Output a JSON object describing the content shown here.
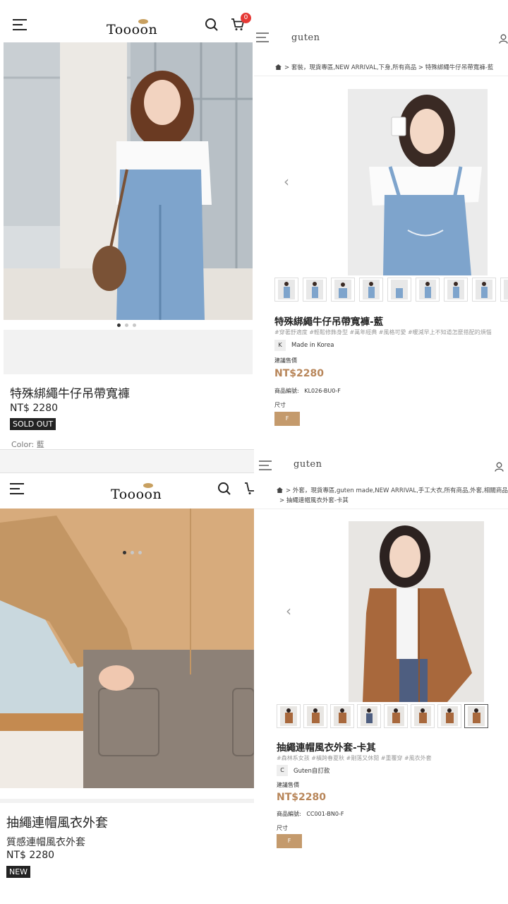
{
  "top_left": {
    "logo": "Toooon",
    "cart_count": "0",
    "product_title": "特殊綁繩牛仔吊帶寬褲",
    "price": "NT$ 2280",
    "status_badge": "SOLD OUT",
    "color_label": "Color: 藍",
    "carousel_active_index": 0,
    "carousel_count": 3
  },
  "top_right": {
    "logo": "guten",
    "breadcrumb": ">   套裝，現貨專區,NEW ARRIVAL,下身,所有商品   >   特殊綁繩牛仔吊帶寬褲-藍",
    "product_title": "特殊綁繩牛仔吊帶寬褲-藍",
    "tags": "#穿著舒適度 #輕鬆修飾身型 #萬年經典 #風格可愛 #暖減早上不知道怎麼搭配的煩惱",
    "origin_code": "K",
    "origin_text": "Made in Korea",
    "price_label": "建議售價",
    "price": "NT$2280",
    "sku_label": "商品編號:",
    "sku": "KL026-BU0-F",
    "size_label": "尺寸",
    "size_option": "F",
    "thumb_count": 9
  },
  "bottom_left": {
    "logo": "Toooon",
    "product_title": "抽繩連帽風衣外套",
    "subtitle": "質感連帽風衣外套",
    "price": "NT$ 2280",
    "status_badge": "NEW",
    "carousel_active_index": 0,
    "carousel_count": 3
  },
  "bottom_right": {
    "logo": "guten",
    "breadcrumb_line1": ">   外套，現貨專區,guten made,NEW ARRIVAL,手工大衣,所有商品,外套,相關商品",
    "breadcrumb_line2": ">   抽繩連帽風衣外套-卡其",
    "product_title": "抽繩連帽風衣外套-卡其",
    "tags": "#森林系女孩 #橫跨春夏秋 #剛落又休閒 #重覆穿 #風衣外套",
    "origin_code": "C",
    "origin_text": "Guten自訂款",
    "price_label": "建議售價",
    "price": "NT$2280",
    "sku_label": "商品編號:",
    "sku": "CC001-BN0-F",
    "size_label": "尺寸",
    "size_option": "F",
    "thumb_count": 8,
    "selected_thumb_index": 7
  },
  "colors": {
    "price_accent": "#b8865a",
    "size_button": "#c49a6c",
    "denim": "#7ea4cc",
    "khaki": "#a8683c",
    "badge_red": "#e53935"
  },
  "icons": [
    "menu-icon",
    "search-icon",
    "cart-icon",
    "user-icon",
    "home-icon",
    "chevron-left-icon"
  ]
}
